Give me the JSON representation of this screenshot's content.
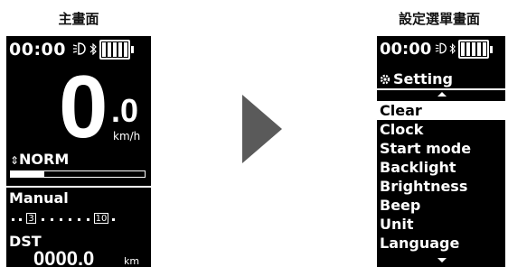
{
  "left_panel": {
    "title": "主畫面"
  },
  "right_panel": {
    "title": "設定選單畫面"
  },
  "main_screen": {
    "time": "00:00",
    "battery_level": 1.0,
    "speed_integer": "0",
    "speed_decimal": ".0",
    "speed_unit": "km/h",
    "assist_mode": "NORM",
    "assist_level": 0.25,
    "shift_mode": "Manual",
    "front_gear": "3",
    "rear_gear": "10",
    "distance_label": "DST",
    "distance_value": "0000.0",
    "distance_unit": "km"
  },
  "settings_screen": {
    "time": "00:00",
    "header": "Setting",
    "menu_items": [
      "Clear",
      "Clock",
      "Start mode",
      "Backlight",
      "Brightness",
      "Beep",
      "Unit",
      "Language"
    ],
    "selected_index": 0
  },
  "colors": {
    "screen_bg": "#000000",
    "screen_fg": "#ffffff",
    "arrow": "#5a5a5a"
  },
  "icons": [
    "light-icon",
    "bluetooth-icon",
    "battery-icon",
    "gear-setting-icon",
    "play-arrow-icon"
  ]
}
